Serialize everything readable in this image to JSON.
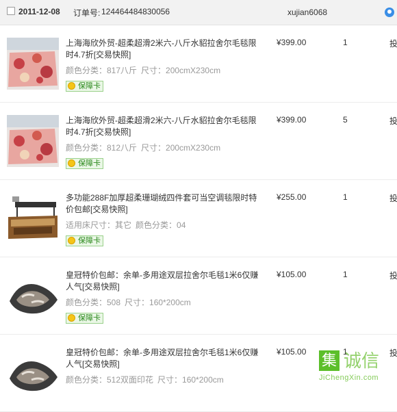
{
  "order": {
    "date": "2011-12-08",
    "order_no_label": "订单号:",
    "order_no": "124464484830056",
    "seller": "xujian6068"
  },
  "items": [
    {
      "title": "上海海欣外贸-超柔超滑2米六-八斤水貂拉舍尔毛毯限时4.7折",
      "snapshot": "[交易快照]",
      "attrs": [
        "颜色分类：817八斤",
        "尺寸：200cmX230cm"
      ],
      "badge": "保障卡",
      "price": "¥399.00",
      "qty": "1",
      "action": "投"
    },
    {
      "title": "上海海欣外贸-超柔超滑2米六-八斤水貂拉舍尔毛毯限时4.7折",
      "snapshot": "[交易快照]",
      "attrs": [
        "颜色分类：812八斤",
        "尺寸：200cmX230cm"
      ],
      "badge": "保障卡",
      "price": "¥399.00",
      "qty": "5",
      "action": "投"
    },
    {
      "title": "多功能288F加厚超柔珊瑚绒四件套可当空调毯限时特价包邮",
      "snapshot": "[交易快照]",
      "attrs": [
        "适用床尺寸：其它",
        "颜色分类：04"
      ],
      "badge": "保障卡",
      "price": "¥255.00",
      "qty": "1",
      "action": "投"
    },
    {
      "title": "皇冠特价包邮：余单-多用途双层拉舍尔毛毯1米6仅赚人气",
      "snapshot": "[交易快照]",
      "attrs": [
        "颜色分类：508",
        "尺寸：160*200cm"
      ],
      "badge": "保障卡",
      "price": "¥105.00",
      "qty": "1",
      "action": "投"
    },
    {
      "title": "皇冠特价包邮：余单-多用途双层拉舍尔毛毯1米6仅赚人气",
      "snapshot": "[交易快照]",
      "attrs": [
        "颜色分类：512双面印花",
        "尺寸：160*200cm"
      ],
      "badge": "",
      "price": "¥105.00",
      "qty": "1",
      "action": "投"
    }
  ],
  "watermark": {
    "box_char": "集",
    "cn": "诚信",
    "en": "JiChengXin.com"
  },
  "colors": {
    "header_bg": "#f2f2f2",
    "badge_green": "#2d8a1e",
    "watermark_green": "#6fc23c"
  }
}
